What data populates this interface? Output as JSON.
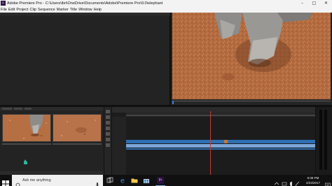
{
  "window": {
    "app_icon_text": "Pr",
    "title": "Adobe Premiere Pro - C:\\Users\\ibri\\OneDrive\\Documents\\Adobe\\Premiere Pro\\9.0\\elephant"
  },
  "menu": {
    "items": [
      "File",
      "Edit",
      "Project",
      "Clip",
      "Sequence",
      "Marker",
      "Title",
      "Window",
      "Help"
    ]
  },
  "taskbar": {
    "search_placeholder": "Ask me anything",
    "premiere_label": "Pr",
    "time": "6:08 PM",
    "date": "4/23/2017"
  },
  "icons": {
    "start": "windows-start-icon",
    "search": "search-icon",
    "microphone": "microphone-icon",
    "task_view": "task-view-icon",
    "edge": "edge-icon",
    "file_explorer": "file-explorer-icon",
    "store": "store-icon",
    "premiere": "premiere-pro-icon",
    "notifications": "notification-icon"
  },
  "colors": {
    "video_track": "#2f6fb3",
    "audio_track": "#7aa6d8",
    "playhead": "#c23b3b",
    "premiere_brand": "#2a1140"
  }
}
